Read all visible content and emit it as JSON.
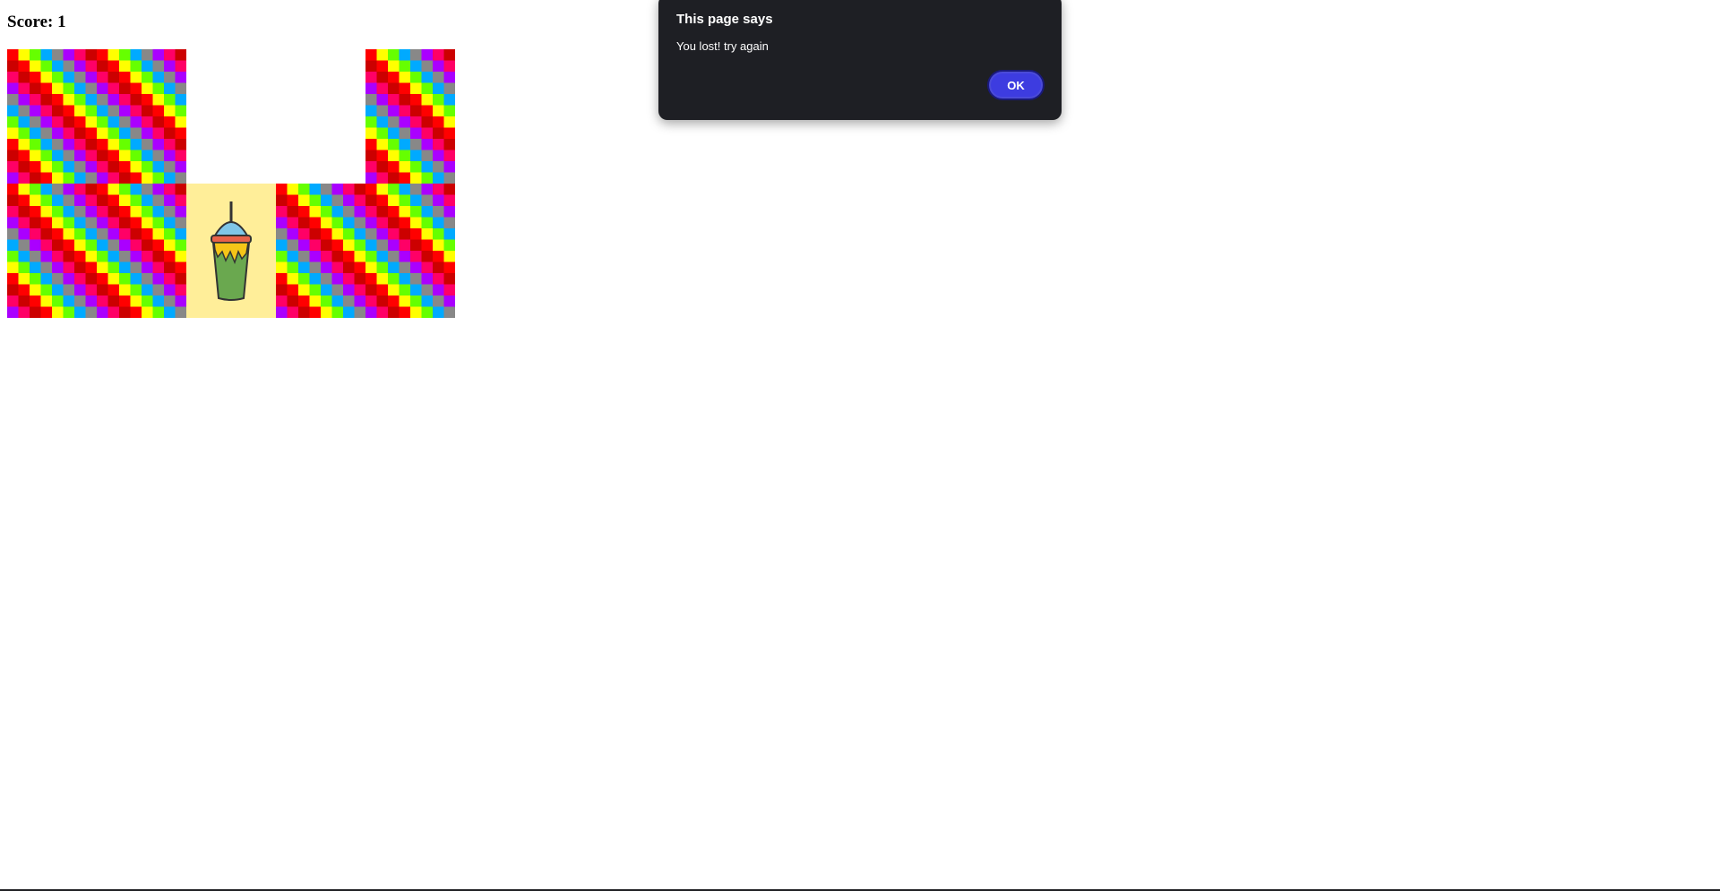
{
  "score": {
    "text": "Score: 1"
  },
  "board": {
    "rows": 2,
    "cols": 5,
    "tiles": [
      [
        "pattern",
        "pattern",
        "empty",
        "empty",
        "pattern"
      ],
      [
        "pattern",
        "pattern",
        "cup",
        "pattern",
        "pattern"
      ]
    ],
    "pattern_colors": [
      "#ff0000",
      "#ffff00",
      "#66ff00",
      "#00aaff",
      "#888888",
      "#aa00ff",
      "#ff0066",
      "#cc0000"
    ],
    "cup_background": "#ffee99",
    "cup_icon": "slushie-cup-icon"
  },
  "dialog": {
    "title": "This page says",
    "message": "You lost! try again",
    "ok_label": "OK",
    "background": "#1e1f24",
    "button_color": "#3d3ce0"
  }
}
